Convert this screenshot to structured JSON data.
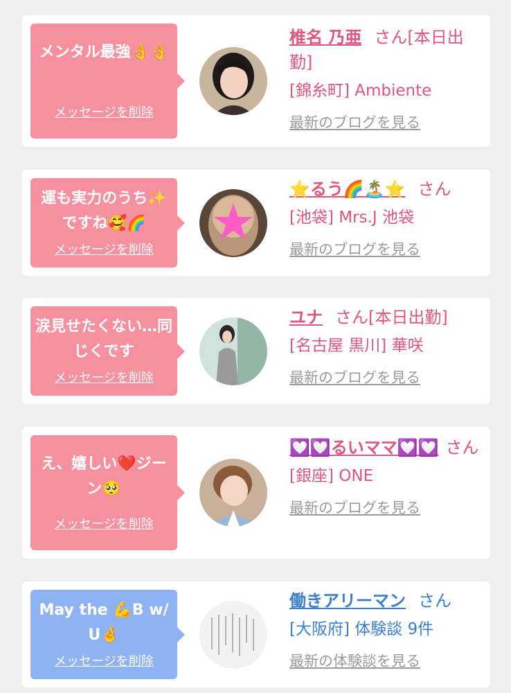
{
  "delete_label": "メッセージを削除",
  "colors": {
    "card_bg": "#ffffff",
    "page_bg": "#efeff0",
    "bubble_pink": "#f5909f",
    "bubble_blue": "#8fb2f2",
    "name_pink": "#e0557b",
    "name_blue": "#3a7fd0",
    "blog_gray": "#9a9a9a"
  },
  "items": [
    {
      "message": "メンタル最強👌👌",
      "name": "椎名 乃亜",
      "suffix": "さん[本日出勤]",
      "shop": "[錦糸町] Ambiente",
      "blog_link": "最新のブログを見る",
      "avatar_icon": "woman-portrait-photo"
    },
    {
      "message": "運も実力のうち✨ですね🥰🌈",
      "name": "⭐るう🌈🏝️⭐",
      "suffix": "さん",
      "shop": "[池袋] Mrs.J 池袋",
      "blog_link": "最新のブログを見る",
      "avatar_icon": "star-blurred-photo"
    },
    {
      "message": "涙見せたくない…同じくです",
      "name": "ユナ",
      "suffix": "さん[本日出勤]",
      "shop": "[名古屋 黒川] 華咲",
      "blog_link": "最新のブログを見る",
      "avatar_icon": "woman-standing-photo"
    },
    {
      "message": "え、嬉しい❤️ジーン🥺",
      "name": "💟💟るいママ💟💟",
      "suffix": "さん",
      "shop": "[銀座] ONE",
      "blog_link": "最新のブログを見る",
      "avatar_icon": "woman-kimono-photo"
    },
    {
      "message": "May the 💪B w/U🤞",
      "name": "働きアリーマン",
      "suffix": "さん",
      "shop": "[大阪府] 体験談 9件",
      "blog_link": "最新の体験談を見る",
      "avatar_icon": "handwritten-letter-photo"
    }
  ]
}
